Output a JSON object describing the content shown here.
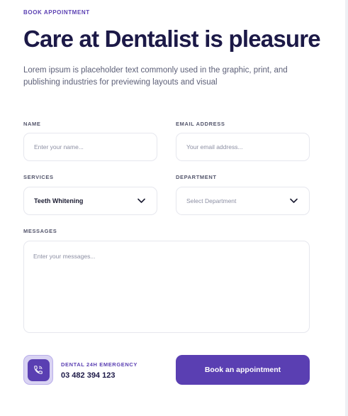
{
  "header": {
    "eyebrow": "BOOK APPOINTMENT",
    "title": "Care at Dentalist is pleasure",
    "description": "Lorem ipsum is placeholder text commonly used in the graphic, print, and publishing industries for previewing layouts and visual"
  },
  "form": {
    "name": {
      "label": "NAME",
      "placeholder": "Enter your name..."
    },
    "email": {
      "label": "EMAIL ADDRESS",
      "placeholder": "Your email address..."
    },
    "services": {
      "label": "SERVICES",
      "value": "Teeth Whitening"
    },
    "department": {
      "label": "DEPARTMENT",
      "value": "Select Department"
    },
    "messages": {
      "label": "MESSAGES",
      "placeholder": "Enter your messages..."
    }
  },
  "emergency": {
    "label": "DENTAL 24H EMERGENCY",
    "phone": "03 482 394 123",
    "icon": "phone-icon"
  },
  "submit": {
    "label": "Book an appointment"
  },
  "colors": {
    "accent": "#5a3fb2",
    "heading": "#1c1947",
    "border": "#e6e7ee",
    "accent_light": "#d9d3f3"
  }
}
